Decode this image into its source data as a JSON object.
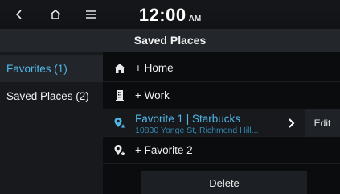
{
  "status_bar": {
    "back_icon": "chevron-left-icon",
    "home_icon": "home-icon",
    "menu_icon": "hamburger-menu-icon",
    "time": "12:00",
    "ampm": "AM"
  },
  "header": {
    "title": "Saved Places"
  },
  "sidebar": {
    "items": [
      {
        "label": "Favorites (1)",
        "active": true
      },
      {
        "label": "Saved Places (2)",
        "active": false
      }
    ]
  },
  "list": {
    "rows": [
      {
        "icon": "house-icon",
        "label": "+ Home"
      },
      {
        "icon": "building-icon",
        "label": "+ Work"
      },
      {
        "icon": "favorite-pin-icon",
        "title": "Favorite 1 | Starbucks",
        "address": "10830 Yonge St, Richmond Hill...",
        "edit_label": "Edit"
      },
      {
        "icon": "favorite-pin-icon",
        "label": "+ Favorite 2"
      }
    ]
  },
  "delete_label": "Delete",
  "colors": {
    "accent": "#4fb6e6",
    "background": "#0b0c0e",
    "panel": "#17191d"
  }
}
